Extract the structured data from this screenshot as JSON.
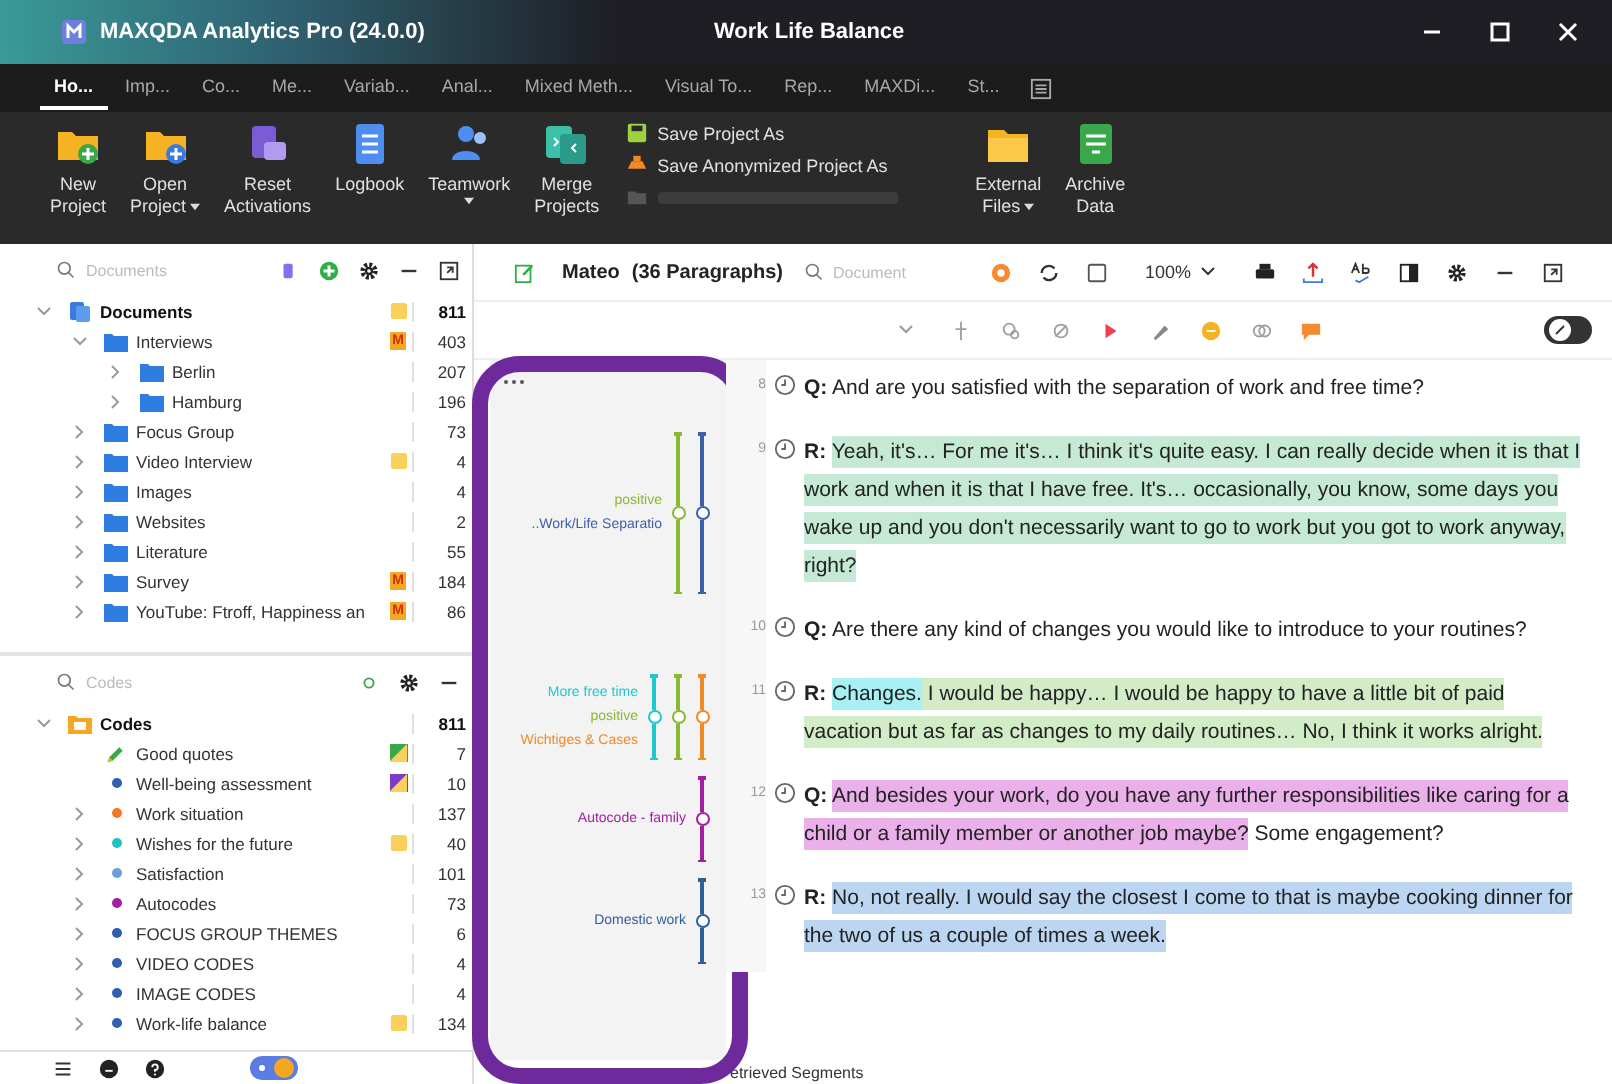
{
  "window": {
    "app_title": "MAXQDA Analytics Pro (24.0.0)",
    "title": "Work Life Balance"
  },
  "ribbon_tabs": [
    {
      "label": "Ho...",
      "selected": true
    },
    {
      "label": "Imp...",
      "selected": false
    },
    {
      "label": "Co...",
      "selected": false
    },
    {
      "label": "Me...",
      "selected": false
    },
    {
      "label": "Variab...",
      "selected": false
    },
    {
      "label": "Anal...",
      "selected": false
    },
    {
      "label": "Mixed Meth...",
      "selected": false
    },
    {
      "label": "Visual To...",
      "selected": false
    },
    {
      "label": "Rep...",
      "selected": false
    },
    {
      "label": "MAXDi...",
      "selected": false
    },
    {
      "label": "St...",
      "selected": false
    }
  ],
  "ribbon": {
    "buttons": [
      {
        "lines": [
          "New",
          "Project"
        ],
        "dropdown": false
      },
      {
        "lines": [
          "Open",
          "Project"
        ],
        "dropdown": true
      },
      {
        "lines": [
          "Reset",
          "Activations"
        ],
        "dropdown": false
      },
      {
        "lines": [
          "Logbook"
        ],
        "dropdown": false
      },
      {
        "lines": [
          "Teamwork"
        ],
        "dropdown": true
      },
      {
        "lines": [
          "Merge",
          "Projects"
        ],
        "dropdown": false
      }
    ],
    "small_buttons": [
      {
        "label": "Save Project As"
      },
      {
        "label": "Save Anonymized Project As"
      }
    ],
    "buttons_right": [
      {
        "lines": [
          "External",
          "Files"
        ],
        "dropdown": true
      },
      {
        "lines": [
          "Archive",
          "Data"
        ],
        "dropdown": false
      }
    ]
  },
  "documents": {
    "placeholder": "Documents",
    "tree": [
      {
        "label": "Documents",
        "count": "811",
        "expanded": true,
        "note": true,
        "children": [
          {
            "label": "Interviews",
            "count": "403",
            "expanded": true,
            "badge": "M",
            "children": [
              {
                "label": "Berlin",
                "count": "207",
                "expanded": false
              },
              {
                "label": "Hamburg",
                "count": "196",
                "expanded": false
              }
            ]
          },
          {
            "label": "Focus Group",
            "count": "73",
            "expanded": false
          },
          {
            "label": "Video Interview",
            "count": "4",
            "expanded": false,
            "note": true
          },
          {
            "label": "Images",
            "count": "4",
            "expanded": false
          },
          {
            "label": "Websites",
            "count": "2",
            "expanded": false
          },
          {
            "label": "Literature",
            "count": "55",
            "expanded": false
          },
          {
            "label": "Survey",
            "count": "184",
            "expanded": false,
            "badge": "M"
          },
          {
            "label": "YouTube: Ftroff, Happiness an",
            "count": "86",
            "expanded": false,
            "badge": "M"
          }
        ]
      }
    ]
  },
  "codes": {
    "placeholder": "Codes",
    "root": {
      "label": "Codes",
      "count": "811",
      "expanded": true
    },
    "items": [
      {
        "label": "Good quotes",
        "count": "7",
        "kind": "pencil",
        "flag": {
          "color": "#3aa84a"
        }
      },
      {
        "label": "Well-being assessment",
        "count": "10",
        "kind": "dot",
        "color": "#2f5fb0",
        "flag": {
          "color": "#7a3cc8"
        }
      },
      {
        "label": "Work situation",
        "count": "137",
        "kind": "dot",
        "color": "#f07820",
        "expanded": false
      },
      {
        "label": "Wishes for the future",
        "count": "40",
        "kind": "dot",
        "color": "#22c0c0",
        "expanded": false,
        "note": true
      },
      {
        "label": "Satisfaction",
        "count": "101",
        "kind": "dot",
        "color": "#6a9fd8",
        "expanded": false
      },
      {
        "label": "Autocodes",
        "count": "73",
        "kind": "dot",
        "color": "#a020a0",
        "expanded": false
      },
      {
        "label": "FOCUS GROUP THEMES",
        "count": "6",
        "kind": "dot",
        "color": "#2f5fb0",
        "expanded": false
      },
      {
        "label": "VIDEO CODES",
        "count": "4",
        "kind": "dot",
        "color": "#2f5fb0",
        "expanded": false
      },
      {
        "label": "IMAGE CODES",
        "count": "4",
        "kind": "dot",
        "color": "#2f5fb0",
        "expanded": false
      },
      {
        "label": "Work-life balance",
        "count": "134",
        "kind": "dot",
        "color": "#2f5fb0",
        "expanded": false,
        "note": true
      }
    ]
  },
  "browser": {
    "document": "Mateo",
    "paragraphs_count": "(36 Paragraphs)",
    "placeholder": "Document",
    "zoom": "100%"
  },
  "paragraphs": [
    {
      "number": "8",
      "speaker": "Q:",
      "segments": [
        {
          "text": "And are you satisfied with the separation of work and free time?"
        }
      ]
    },
    {
      "number": "9",
      "speaker": "R:",
      "segments": [
        {
          "text": "Yeah, it's… For me it's… I think it's quite easy. I can really decide when it is that I work and when it is that I have free. It's… occasionally, you know, some days you wake up and you don't necessarily want to go to work but you got to work anyway, right?",
          "color": "#c6e9d6"
        }
      ],
      "codes": [
        {
          "label": "positive",
          "color": "#8ab832"
        },
        {
          "label": "..Work/Life Separatio",
          "color": "#3b5fa8"
        }
      ]
    },
    {
      "number": "10",
      "speaker": "Q:",
      "segments": [
        {
          "text": "Are there any kind of changes you would like to introduce to your routines?"
        }
      ]
    },
    {
      "number": "11",
      "speaker": "R:",
      "segments": [
        {
          "text": "Changes.",
          "color": "#a8f0f4"
        },
        {
          "text": " I would be happy… I would be happy to have a little bit of paid vacation but as far as changes to my daily routines… No, I think it works alright.",
          "color": "#d3ecc8"
        }
      ],
      "codes": [
        {
          "label": "More free time",
          "color": "#1ec8d0"
        },
        {
          "label": "positive",
          "color": "#8ab832"
        },
        {
          "label": "Wichtiges & Cases",
          "color": "#f08a24"
        }
      ]
    },
    {
      "number": "12",
      "speaker": "Q:",
      "segments": [
        {
          "text": "And besides your work, do you have any further responsibilities like caring for a child or a family member or another job maybe?",
          "color": "#eab0ea"
        },
        {
          "text": " Some engagement?"
        }
      ],
      "codes": [
        {
          "label": "Autocode - family",
          "color": "#a020a0"
        }
      ]
    },
    {
      "number": "13",
      "speaker": "R:",
      "segments": [
        {
          "text": "No, not really. I would say the closest I come to that is maybe cooking dinner for the two of us a couple of times a week.",
          "color": "#bcd6f2"
        }
      ],
      "codes": [
        {
          "label": "Domestic work",
          "color": "#2f5f98"
        }
      ]
    }
  ],
  "bottom_tab": "etrieved Segments"
}
